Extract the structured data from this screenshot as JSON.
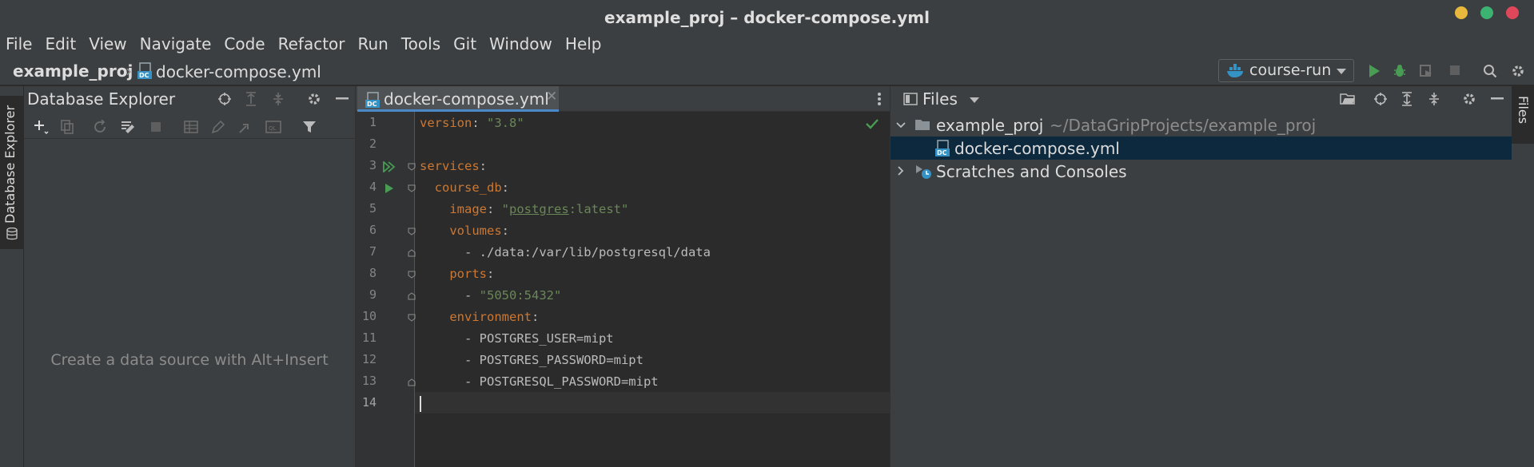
{
  "window": {
    "title": "example_proj – docker-compose.yml"
  },
  "menu": [
    "File",
    "Edit",
    "View",
    "Navigate",
    "Code",
    "Refactor",
    "Run",
    "Tools",
    "Git",
    "Window",
    "Help"
  ],
  "navbar": {
    "project": "example_proj",
    "file": "docker-compose.yml",
    "run_config": "course-run"
  },
  "db_explorer": {
    "title": "Database Explorer",
    "empty_text": "Create a data source with Alt+Insert",
    "stripe_label": "Database Explorer"
  },
  "editor": {
    "tab_label": "docker-compose.yml",
    "line_numbers": [
      "1",
      "2",
      "3",
      "4",
      "5",
      "6",
      "7",
      "8",
      "9",
      "10",
      "11",
      "12",
      "13",
      "14"
    ],
    "lines": {
      "l1_key": "version",
      "l1_val": "\"3.8\"",
      "l3_key": "services",
      "l4_key": "course_db",
      "l5_key": "image",
      "l5_q1": "\"",
      "l5_img": "postgres",
      "l5_tag": ":latest\"",
      "l6_key": "volumes",
      "l7_val": "- ./data:/var/lib/postgresql/data",
      "l8_key": "ports",
      "l9_dash": "- ",
      "l9_val": "\"5050:5432\"",
      "l10_key": "environment",
      "l11_val": "- POSTGRES_USER=mipt",
      "l12_val": "- POSTGRES_PASSWORD=mipt",
      "l13_val": "- POSTGRESQL_PASSWORD=mipt"
    }
  },
  "files": {
    "title": "Files",
    "stripe_label": "Files",
    "tree": {
      "project_name": "example_proj",
      "project_path": "~/DataGripProjects/example_proj",
      "file": "docker-compose.yml",
      "scratches": "Scratches and Consoles"
    }
  },
  "colors": {
    "accent": "#4a88c7",
    "keyword": "#cc7832",
    "string": "#6a8759",
    "run": "#499c54"
  }
}
